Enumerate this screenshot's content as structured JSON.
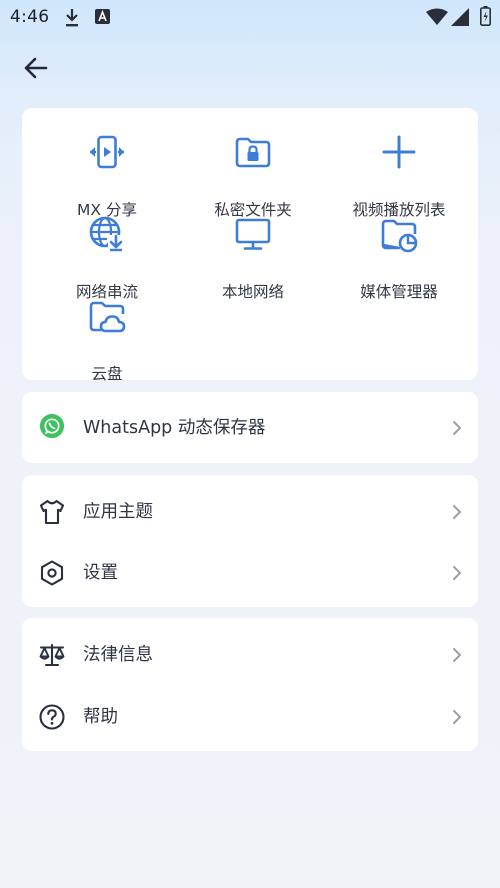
{
  "status_bar": {
    "time": "4:46",
    "icons": [
      "download-icon",
      "text-a-icon",
      "wifi-icon",
      "signal-icon",
      "battery-charging-icon"
    ]
  },
  "header": {
    "back_icon": "arrow-left-icon"
  },
  "grid": {
    "items": [
      {
        "label": "MX 分享",
        "icon": "mx-share-icon"
      },
      {
        "label": "私密文件夹",
        "icon": "private-folder-icon"
      },
      {
        "label": "视频播放列表",
        "icon": "plus-icon"
      },
      {
        "label": "网络串流",
        "icon": "network-stream-icon"
      },
      {
        "label": "本地网络",
        "icon": "monitor-icon"
      },
      {
        "label": "媒体管理器",
        "icon": "media-manager-icon"
      },
      {
        "label": "云盘",
        "icon": "cloud-folder-icon"
      }
    ]
  },
  "whatsapp": {
    "label": "WhatsApp 动态保存器",
    "icon": "whatsapp-icon"
  },
  "settings_group": {
    "items": [
      {
        "label": "应用主题",
        "icon": "tshirt-icon"
      },
      {
        "label": "设置",
        "icon": "hex-settings-icon"
      }
    ]
  },
  "info_group": {
    "items": [
      {
        "label": "法律信息",
        "icon": "scale-icon"
      },
      {
        "label": "帮助",
        "icon": "help-icon"
      }
    ]
  },
  "colors": {
    "accent": "#3d7cd9",
    "whatsapp": "#3ec15e",
    "icon_dark": "#2b3040",
    "chevron": "#9aa0ab"
  }
}
